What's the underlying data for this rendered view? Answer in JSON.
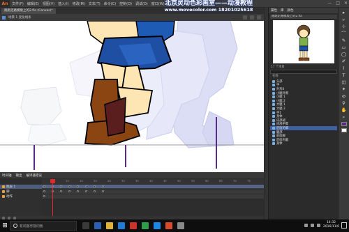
{
  "app": {
    "logo": "An"
  },
  "menu": [
    "文件(F)",
    "编辑(E)",
    "视图(V)",
    "插入(I)",
    "修改(M)",
    "文本(T)",
    "命令(C)",
    "控制(O)",
    "调试(D)",
    "窗口(W)",
    "帮助(H)"
  ],
  "window_controls": [
    "—",
    "□",
    "✕"
  ],
  "watermark": {
    "title": "北京灵动色彩画室——动漫教程",
    "url_line": "www.movecolor.com  18201025618"
  },
  "document": {
    "tab": "跑跑走路模版上的2.fla (Canvas)*",
    "scene": "场景 1   变化线条"
  },
  "timeline": {
    "tabs": [
      "时间轴",
      "输出",
      "编译器错误"
    ],
    "ruler_ticks": [
      "5",
      "10",
      "15",
      "20",
      "25",
      "30",
      "35",
      "40",
      "45",
      "50",
      "55",
      "60",
      "65",
      "70",
      "75"
    ],
    "layers": [
      {
        "name": "图层 1",
        "selected": true
      },
      {
        "name": "脚",
        "selected": false
      },
      {
        "name": "动作",
        "selected": false
      }
    ]
  },
  "library": {
    "tabs": [
      "属性",
      "库",
      "颜色"
    ],
    "document_name": "跑跑走路模版上的2.fla",
    "count": "17 个项目",
    "column_name": "名称",
    "items": [
      {
        "name": "头部",
        "selected": false
      },
      {
        "name": "手",
        "selected": false
      },
      {
        "name": "外形0",
        "selected": false
      },
      {
        "name": "小腿外侧",
        "selected": false
      },
      {
        "name": "小腿 1",
        "selected": false
      },
      {
        "name": "小腿 2",
        "selected": false
      },
      {
        "name": "大腿 1",
        "selected": false
      },
      {
        "name": "大腿 2",
        "selected": false
      },
      {
        "name": "手1",
        "selected": false
      },
      {
        "name": "身体",
        "selected": false
      },
      {
        "name": "内部裙",
        "selected": false
      },
      {
        "name": "内部手臂",
        "selected": false
      },
      {
        "name": "后面的脚",
        "selected": true
      },
      {
        "name": "腿部",
        "selected": false
      },
      {
        "name": "前面脚",
        "selected": false
      },
      {
        "name": "后面内腿",
        "selected": false
      },
      {
        "name": "身体",
        "selected": false
      }
    ]
  },
  "tools": [
    "▸",
    "▹",
    "⊹",
    "⌒",
    "✎",
    "▭",
    "◯",
    "✐",
    "⌇",
    "T",
    "◫",
    "✦",
    "⊘",
    "⚲",
    "✋",
    "⌕"
  ],
  "colors": {
    "stroke": "#5b2a86",
    "fill": "#ffffff",
    "character_hair": "#1e5bb5",
    "character_shorts": "#1f4fa3",
    "character_skin": "#fde6b4",
    "boot": "#8b4513"
  },
  "taskbar": {
    "start_icon": "⊞",
    "search_placeholder": "有问题尽管问我",
    "clock_time": "14:32",
    "clock_date": "2016/11/6"
  }
}
